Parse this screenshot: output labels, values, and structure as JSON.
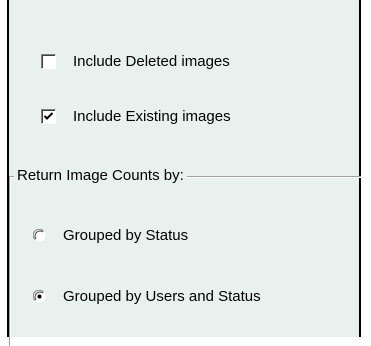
{
  "options": {
    "include_deleted": {
      "label": "Include Deleted images",
      "checked": false
    },
    "include_existing": {
      "label": "Include Existing images",
      "checked": true
    }
  },
  "return_counts": {
    "legend": "Return Image Counts by:",
    "choices": [
      {
        "label": "Grouped by Status",
        "selected": false
      },
      {
        "label": "Grouped by Users and Status",
        "selected": true
      }
    ]
  },
  "colors": {
    "panel_background": "#e9f1ef",
    "border": "#000000"
  }
}
